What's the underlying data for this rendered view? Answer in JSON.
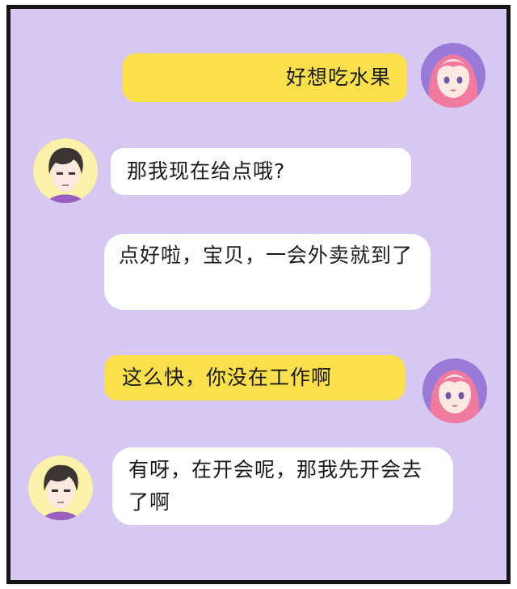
{
  "messages": [
    {
      "sender": "girl",
      "text": "好想吃水果",
      "color": "#fbe04b"
    },
    {
      "sender": "boy",
      "text": "那我现在给点哦?",
      "color": "#ffffff"
    },
    {
      "sender": "boy",
      "text": "点好啦，宝贝，一会外卖就到了",
      "color": "#ffffff"
    },
    {
      "sender": "girl",
      "text": "这么快，你没在工作啊",
      "color": "#fbe04b"
    },
    {
      "sender": "boy",
      "text": "有呀，在开会呢，那我先开会去了啊",
      "color": "#ffffff"
    }
  ],
  "colors": {
    "background": "#d6c8f0",
    "frame_border": "#141414",
    "girl_bubble": "#fbe04b",
    "boy_bubble": "#ffffff",
    "girl_avatar_bg": "#9a7ad8",
    "boy_avatar_bg": "#fbf1a8"
  },
  "avatars": {
    "girl": "pink-haired-girl-icon",
    "boy": "dark-haired-boy-icon"
  }
}
